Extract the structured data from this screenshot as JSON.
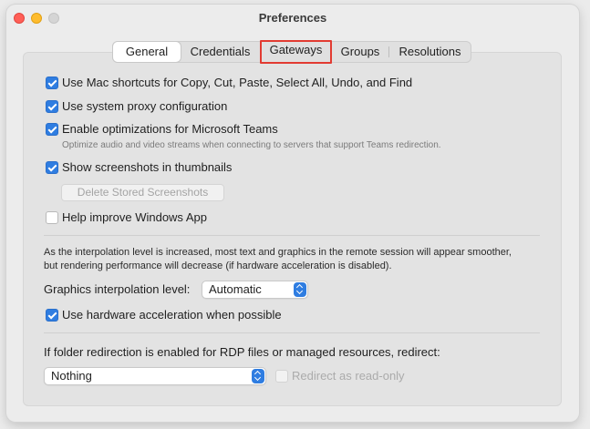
{
  "window": {
    "title": "Preferences"
  },
  "tabs": [
    {
      "label": "General",
      "selected": true
    },
    {
      "label": "Credentials",
      "selected": false
    },
    {
      "label": "Gateways",
      "selected": false,
      "highlighted": true
    },
    {
      "label": "Groups",
      "selected": false
    },
    {
      "label": "Resolutions",
      "selected": false
    }
  ],
  "options": {
    "mac_shortcuts": {
      "label": "Use Mac shortcuts for Copy, Cut, Paste, Select All, Undo, and Find",
      "checked": true
    },
    "system_proxy": {
      "label": "Use system proxy configuration",
      "checked": true
    },
    "teams_opt": {
      "label": "Enable optimizations for Microsoft Teams",
      "checked": true,
      "hint": "Optimize audio and video streams when connecting to servers that support Teams redirection."
    },
    "thumbnails": {
      "label": "Show screenshots in thumbnails",
      "checked": true
    },
    "delete_screenshots_label": "Delete Stored Screenshots",
    "help_improve": {
      "label": "Help improve Windows App",
      "checked": false
    }
  },
  "graphics": {
    "info_line1": "As the interpolation level is increased, most text and graphics in the remote session will appear smoother,",
    "info_line2": "but rendering performance will decrease (if hardware acceleration is disabled).",
    "interp_label": "Graphics interpolation level:",
    "interp_value": "Automatic",
    "hw_accel": {
      "label": "Use hardware acceleration when possible",
      "checked": true
    }
  },
  "folder": {
    "label": "If folder redirection is enabled for RDP files or managed resources, redirect:",
    "value": "Nothing",
    "readonly": {
      "label": "Redirect as read-only",
      "checked": false,
      "disabled": true
    }
  },
  "colors": {
    "accent": "#2f7de1",
    "highlight_border": "#e23b32"
  }
}
